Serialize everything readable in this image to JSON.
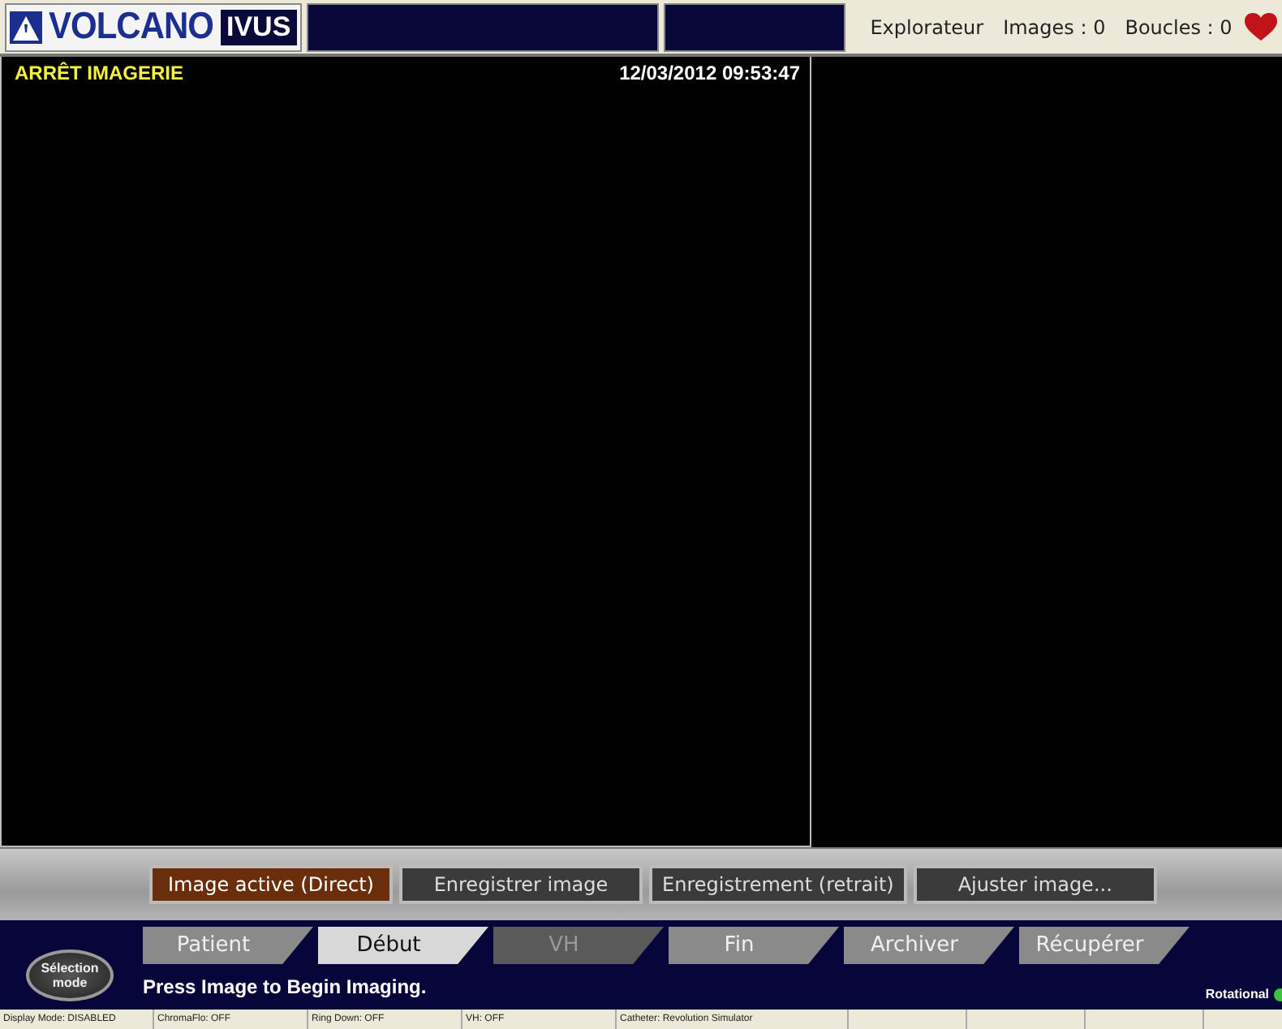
{
  "header": {
    "logo": "VOLCANO",
    "product": "IVUS",
    "items": [
      "Explorateur",
      "Images : 0",
      "Boucles : 0"
    ]
  },
  "viewer": {
    "status": "ARRÊT IMAGERIE",
    "timestamp": "12/03/2012 09:53:47"
  },
  "actions": [
    {
      "label": "Image active (Direct)",
      "selected": true
    },
    {
      "label": "Enregistrer image",
      "selected": false
    },
    {
      "label": "Enregistrement (retrait)",
      "selected": false
    },
    {
      "label": "Ajuster image...",
      "selected": false
    }
  ],
  "mode_button": [
    "Sélection",
    "mode"
  ],
  "tabs": [
    {
      "label": "Patient",
      "selected": false,
      "disabled": false
    },
    {
      "label": "Début",
      "selected": true,
      "disabled": false
    },
    {
      "label": "VH",
      "selected": false,
      "disabled": true
    },
    {
      "label": "Fin",
      "selected": false,
      "disabled": false
    },
    {
      "label": "Archiver",
      "selected": false,
      "disabled": false
    },
    {
      "label": "Récupérer",
      "selected": false,
      "disabled": false
    }
  ],
  "message": "Press Image to Begin Imaging.",
  "catheter_mode": {
    "label": "Rotational",
    "color": "#3cc23c"
  },
  "status_bar": [
    "Display Mode: DISABLED",
    "ChromaFlo: OFF",
    "Ring Down: OFF",
    "VH: OFF",
    "Catheter: Revolution Simulator"
  ]
}
